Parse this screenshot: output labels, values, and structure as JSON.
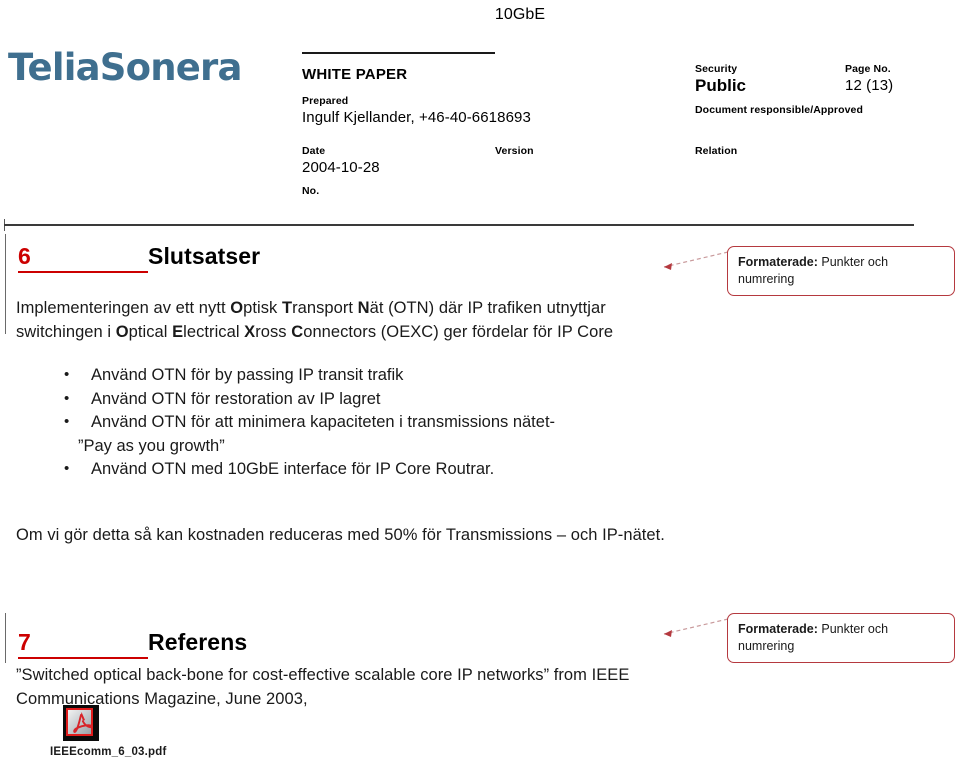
{
  "running_header": "10GbE",
  "logo": {
    "text": "TeliaSonera",
    "color": "#3f6f8f"
  },
  "header": {
    "doc_title": "WHITE PAPER",
    "fields": {
      "prepared_label": "Prepared",
      "prepared_value": "Ingulf Kjellander, +46-40-6618693",
      "date_label": "Date",
      "date_value": "2004-10-28",
      "no_label": "No.",
      "no_value": "",
      "version_label": "Version",
      "version_value": "",
      "security_label": "Security",
      "security_value": "Public",
      "page_no_label": "Page No.",
      "page_no_value": "12 (13)",
      "doc_responsible_label": "Document responsible/Approved",
      "doc_responsible_value": "",
      "relation_label": "Relation",
      "relation_value": ""
    }
  },
  "sections": {
    "conclusions": {
      "number": "6",
      "title": "Slutsatser",
      "intro": "Implementeringen av ett nytt Optisk Transport Nät (OTN) där IP trafiken utnyttjar switchingen i Optical Electrical Xross Connectors (OEXC) ger fördelar för IP Core",
      "bullets": [
        "Använd OTN för by passing IP transit trafik",
        "Använd OTN för restoration av IP lagret",
        "Använd OTN för att minimera kapaciteten i transmissions nätet-",
        "Använd OTN med 10GbE interface för IP Core Routrar."
      ],
      "bullet_3_continuation": "”Pay as you growth”",
      "closing": "Om vi gör detta så kan kostnaden reduceras med 50% för Transmissions – och IP-nätet."
    },
    "reference": {
      "number": "7",
      "title": "Referens",
      "text": "”Switched optical back-bone for cost-effective scalable core IP networks” from IEEE Communications Magazine, June 2003,",
      "attachment_name": "IEEEcomm_6_03.pdf"
    }
  },
  "comments": [
    {
      "label": "Formaterade:",
      "body": " Punkter och numrering"
    },
    {
      "label": "Formaterade:",
      "body": " Punkter och numrering"
    }
  ],
  "colors": {
    "heading_number": "#cc0000",
    "comment_border": "#b5393f",
    "logo_blue": "#3f6f8f"
  }
}
